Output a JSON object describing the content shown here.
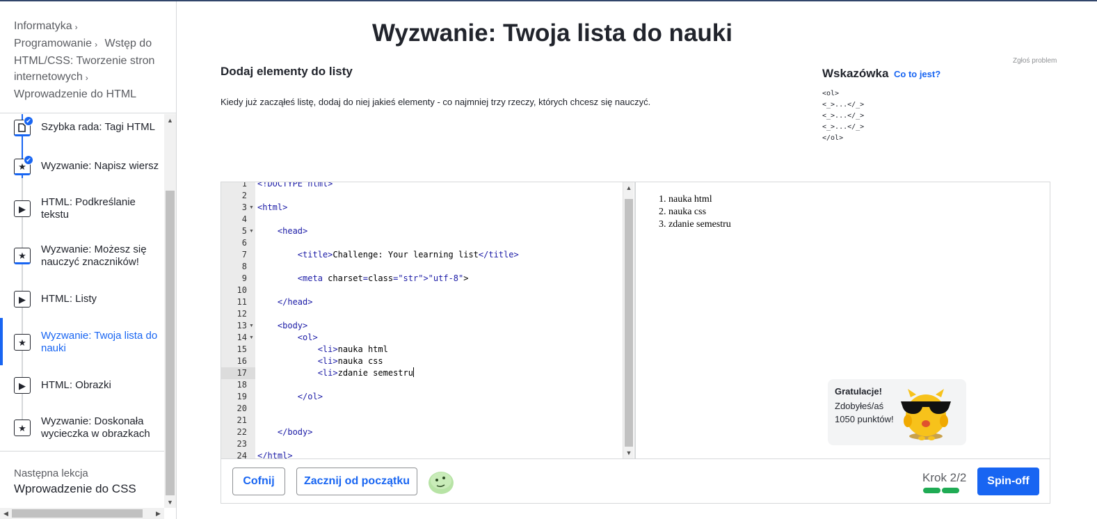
{
  "breadcrumb": [
    {
      "label": "Informatyka"
    },
    {
      "label": "Programowanie"
    },
    {
      "label": "Wstęp do HTML/CSS: Tworzenie stron internetowych"
    },
    {
      "label": "Wprowadzenie do HTML"
    }
  ],
  "lessons": [
    {
      "label": "Szybka rada: Tagi HTML",
      "icon": "document-icon",
      "completed": true
    },
    {
      "label": "Wyzwanie: Napisz wiersz",
      "icon": "star-icon",
      "completed": true
    },
    {
      "label": "HTML: Podkreślanie tekstu",
      "icon": "play-icon",
      "completed": false
    },
    {
      "label": "Wyzwanie: Możesz się nauczyć znaczników!",
      "icon": "star-icon",
      "completed": false
    },
    {
      "label": "HTML: Listy",
      "icon": "play-icon",
      "completed": false
    },
    {
      "label": "Wyzwanie: Twoja lista do nauki",
      "icon": "star-icon",
      "completed": false,
      "active": true
    },
    {
      "label": "HTML: Obrazki",
      "icon": "play-icon",
      "completed": false
    },
    {
      "label": "Wyzwanie: Doskonała wycieczka w obrazkach",
      "icon": "star-icon",
      "completed": false
    }
  ],
  "next_lesson": {
    "caption": "Następna lekcja",
    "title": "Wprowadzenie do CSS"
  },
  "page": {
    "title": "Wyzwanie: Twoja lista do nauki",
    "report_link": "Zgłoś problem",
    "step_title": "Dodaj elementy do listy",
    "step_description": "Kiedy już zacząłeś listę, dodaj do niej jakieś elementy - co najmniej trzy rzeczy, których chcesz się nauczyć."
  },
  "hint": {
    "title": "Wskazówka",
    "link": "Co to jest?",
    "code": "<ol>\n<_>...</_>\n<_>...</_>\n<_>...</_>\n</ol>"
  },
  "editor": {
    "active_line": 17,
    "lines": [
      "<!DOCTYPE html>",
      "",
      "<html>",
      "",
      "    <head>",
      "",
      "        <title>Challenge: Your learning list</title>",
      "",
      "        <meta charset=\"utf-8\">",
      "",
      "    </head>",
      "",
      "    <body>",
      "        <ol>",
      "            <li>nauka html",
      "            <li>nauka css",
      "            <li>zdanie semestru",
      "",
      "        </ol>",
      "",
      "",
      "    </body>",
      "",
      "</html>"
    ],
    "fold_lines": [
      3,
      5,
      13,
      14
    ]
  },
  "preview": {
    "items": [
      "nauka html",
      "nauka css",
      "zdanie semestru"
    ]
  },
  "congrats": {
    "title": "Gratulacje!",
    "message": "Zdobyłeś/aś 1050 punktów!"
  },
  "footer": {
    "back_label": "Cofnij",
    "restart_label": "Zacznij od początku",
    "step_label": "Krok 2/2",
    "steps_total": 2,
    "steps_done": 2,
    "spinoff_label": "Spin-off"
  },
  "colors": {
    "accent": "#1865f2",
    "success": "#1fab54"
  }
}
